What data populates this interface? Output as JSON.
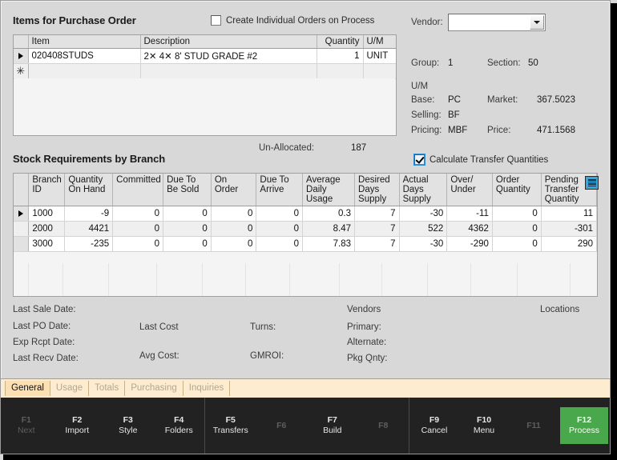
{
  "window": {
    "items_panel_title": "Items for Purchase Order",
    "stock_panel_title": "Stock Requirements by Branch"
  },
  "create_individual": {
    "label": "Create Individual Orders on Process",
    "checked": false
  },
  "items_grid": {
    "columns": [
      "Item",
      "Description",
      "Quantity",
      "U/M"
    ],
    "rows": [
      {
        "marker": "▶",
        "item": "020408STUDS",
        "description": "2✕ 4✕ 8' STUD GRADE #2",
        "quantity": "1",
        "um": "UNIT"
      }
    ],
    "new_row_marker": "✳"
  },
  "unallocated": {
    "label": "Un-Allocated:",
    "value": "187"
  },
  "vendor": {
    "label": "Vendor:",
    "value": "",
    "placeholder": ""
  },
  "details": {
    "group_label": "Group:",
    "group_value": "1",
    "section_label": "Section:",
    "section_value": "50",
    "um_header": "U/M",
    "base_label": "Base:",
    "base_value": "PC",
    "market_label": "Market:",
    "market_value": "367.5023",
    "selling_label": "Selling:",
    "selling_value": "BF",
    "pricing_label": "Pricing:",
    "pricing_value": "MBF",
    "price_label": "Price:",
    "price_value": "471.1568"
  },
  "calc_transfer": {
    "label": "Calculate Transfer Quantities",
    "checked": true
  },
  "stock_grid": {
    "options_icon": "grid-options-icon",
    "columns": [
      "Branch ID",
      "Quantity On Hand",
      "Committed",
      "Due To Be Sold",
      "On Order",
      "Due To Arrive",
      "Average Daily Usage",
      "Desired Days Supply",
      "Actual Days Supply",
      "Over/ Under",
      "Order Quantity",
      "Pending Transfer Quantity"
    ],
    "rows": [
      {
        "marker": "▶",
        "branch_id": "1000",
        "qty_on_hand": "-9",
        "committed": "0",
        "due_to_be_sold": "0",
        "on_order": "0",
        "due_to_arrive": "0",
        "avg_daily_usage": "0.3",
        "desired_days_supply": "7",
        "actual_days_supply": "-30",
        "over_under": "-11",
        "order_quantity": "0",
        "pending_transfer_quantity": "11"
      },
      {
        "marker": "",
        "branch_id": "2000",
        "qty_on_hand": "4421",
        "committed": "0",
        "due_to_be_sold": "0",
        "on_order": "0",
        "due_to_arrive": "0",
        "avg_daily_usage": "8.47",
        "desired_days_supply": "7",
        "actual_days_supply": "522",
        "over_under": "4362",
        "order_quantity": "0",
        "pending_transfer_quantity": "-301"
      },
      {
        "marker": "",
        "branch_id": "3000",
        "qty_on_hand": "-235",
        "committed": "0",
        "due_to_be_sold": "0",
        "on_order": "0",
        "due_to_arrive": "0",
        "avg_daily_usage": "7.83",
        "desired_days_supply": "7",
        "actual_days_supply": "-30",
        "over_under": "-290",
        "order_quantity": "0",
        "pending_transfer_quantity": "290"
      }
    ]
  },
  "footer_info": {
    "last_sale_date_label": "Last Sale Date:",
    "last_sale_date_value": "",
    "last_po_date_label": "Last PO Date:",
    "last_po_date_value": "",
    "exp_rcpt_date_label": "Exp Rcpt Date:",
    "exp_rcpt_date_value": "",
    "last_recv_date_label": "Last Recv Date:",
    "last_recv_date_value": "",
    "last_cost_label": "Last Cost",
    "last_cost_value": "",
    "avg_cost_label": "Avg Cost:",
    "avg_cost_value": "",
    "turns_label": "Turns:",
    "turns_value": "",
    "gmroi_label": "GMROI:",
    "gmroi_value": "",
    "vendors_label": "Vendors",
    "primary_label": "Primary:",
    "primary_value": "",
    "alternate_label": "Alternate:",
    "alternate_value": "",
    "pkg_qnty_label": "Pkg Qnty:",
    "pkg_qnty_value": "",
    "locations_label": "Locations"
  },
  "tabs": [
    {
      "label": "General",
      "active": true
    },
    {
      "label": "Usage",
      "active": false
    },
    {
      "label": "Totals",
      "active": false
    },
    {
      "label": "Purchasing",
      "active": false
    },
    {
      "label": "Inquiries",
      "active": false
    }
  ],
  "fkeys": [
    {
      "num": "F1",
      "label": "Next",
      "enabled": false,
      "primary": false
    },
    {
      "num": "F2",
      "label": "Import",
      "enabled": true,
      "primary": false
    },
    {
      "num": "F3",
      "label": "Style",
      "enabled": true,
      "primary": false
    },
    {
      "num": "F4",
      "label": "Folders",
      "enabled": true,
      "primary": false
    },
    {
      "num": "F5",
      "label": "Transfers",
      "enabled": true,
      "primary": false
    },
    {
      "num": "F6",
      "label": "",
      "enabled": false,
      "primary": false
    },
    {
      "num": "F7",
      "label": "Build",
      "enabled": true,
      "primary": false
    },
    {
      "num": "F8",
      "label": "",
      "enabled": false,
      "primary": false
    },
    {
      "num": "F9",
      "label": "Cancel",
      "enabled": true,
      "primary": false
    },
    {
      "num": "F10",
      "label": "Menu",
      "enabled": true,
      "primary": false
    },
    {
      "num": "F11",
      "label": "",
      "enabled": false,
      "primary": false
    },
    {
      "num": "F12",
      "label": "Process",
      "enabled": true,
      "primary": true
    }
  ],
  "colors": {
    "window_bg": "#d8d8d8",
    "grid_header": "#e2e2e2",
    "tabstrip_bg": "#fdecd0",
    "tab_active_bg": "#fbe0b4",
    "fkeybar_bg": "#222222",
    "process_green": "#49a84b",
    "grid_options_blue": "#33a8dd"
  }
}
